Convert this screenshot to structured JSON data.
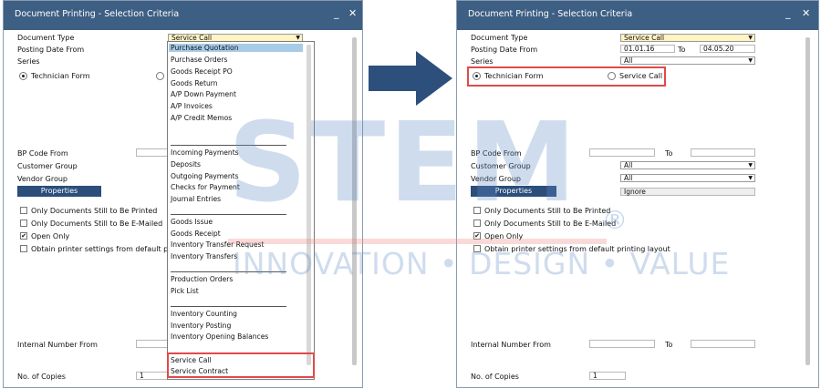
{
  "window_title": "Document Printing - Selection Criteria",
  "controls": {
    "minimize": "_",
    "close": "✕"
  },
  "labels": {
    "document_type": "Document Type",
    "posting_date_from": "Posting Date From",
    "to": "To",
    "series": "Series",
    "technician_form": "Technician Form",
    "service_call": "Service Call",
    "bp_code_from": "BP Code From",
    "customer_group": "Customer Group",
    "vendor_group": "Vendor Group",
    "properties": "Properties",
    "only_printed": "Only Documents Still to Be Printed",
    "only_emailed": "Only Documents Still to Be E-Mailed",
    "open_only": "Open Only",
    "printer_settings": "Obtain printer settings from default printing layout",
    "printer_settings_truncated": "Obtain printer settings from default printin",
    "internal_number_from": "Internal Number From",
    "no_of_copies": "No. of Copies"
  },
  "left": {
    "document_type_value": "Service Call",
    "copies_value": "1",
    "open_only_checked": true,
    "dropdown_options": [
      "Purchase Quotation",
      "Purchase Orders",
      "Goods Receipt PO",
      "Goods Return",
      "A/P Down Payment",
      "A/P Invoices",
      "A/P Credit Memos",
      "Incoming Payments",
      "Deposits",
      "Outgoing Payments",
      "Checks for Payment",
      "Journal Entries",
      "Goods Issue",
      "Goods Receipt",
      "Inventory Transfer Request",
      "Inventory Transfers",
      "Production Orders",
      "Pick List",
      "Inventory Counting",
      "Inventory Posting",
      "Inventory Opening Balances",
      "Service Call",
      "Service Contract"
    ],
    "highlighted_option": "Purchase Quotation"
  },
  "right": {
    "document_type_value": "Service Call",
    "posting_date_from": "01.01.16",
    "posting_date_to": "04.05.20",
    "series_value": "All",
    "customer_group_value": "All",
    "vendor_group_value": "All",
    "properties_value": "Ignore",
    "copies_value": "1",
    "technician_form_selected": true
  },
  "watermark": {
    "logo": "STEM",
    "registered": "®",
    "tagline": "INNOVATION • DESIGN • VALUE"
  },
  "colors": {
    "titlebar": "#3e5f84",
    "button": "#2b4e7a",
    "highlight_box": "#e04a4a",
    "arrow": "#2d4f7c",
    "selected_field": "#fff4c2"
  }
}
